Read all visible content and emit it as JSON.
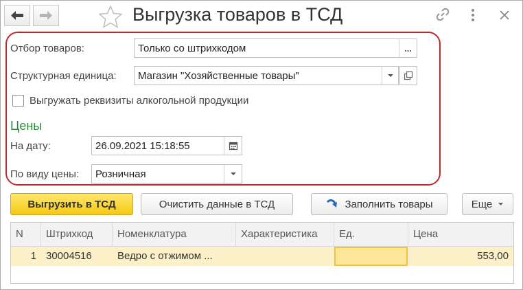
{
  "window": {
    "title": "Выгрузка товаров в ТСД",
    "icons": [
      "arrow-left-icon",
      "arrow-right-icon",
      "star-icon",
      "link-icon",
      "more-vertical-icon",
      "close-icon"
    ]
  },
  "form": {
    "filter_label": "Отбор товаров:",
    "filter_value": "Только со штрихкодом",
    "filter_btn": "...",
    "unit_label": "Структурная единица:",
    "unit_value": "Магазин \"Хозяйственные товары\"",
    "alcohol_label": "Выгружать реквизиты алкогольной продукции",
    "alcohol_checked": false,
    "prices_section": "Цены",
    "date_label": "На дату:",
    "date_value": "26.09.2021 15:18:55",
    "pricetype_label": "По виду цены:",
    "pricetype_value": "Розничная"
  },
  "toolbar": {
    "export_label": "Выгрузить в ТСД",
    "clear_label": "Очистить данные в ТСД",
    "fill_label": "Заполнить товары",
    "more_label": "Еще"
  },
  "table": {
    "columns": [
      "N",
      "Штрихкод",
      "Номенклатура",
      "Характеристика",
      "Ед.",
      "Цена"
    ],
    "rows": [
      {
        "n": "1",
        "barcode": "30004516",
        "item": "Ведро с отжимом ...",
        "characteristic": "",
        "unit": "",
        "price": "553,00"
      }
    ]
  },
  "colors": {
    "accent_yellow": "#f5c815",
    "highlight_red": "#c0282f",
    "section_green": "#2a8a3a",
    "row_selected": "#fbf0c8"
  }
}
